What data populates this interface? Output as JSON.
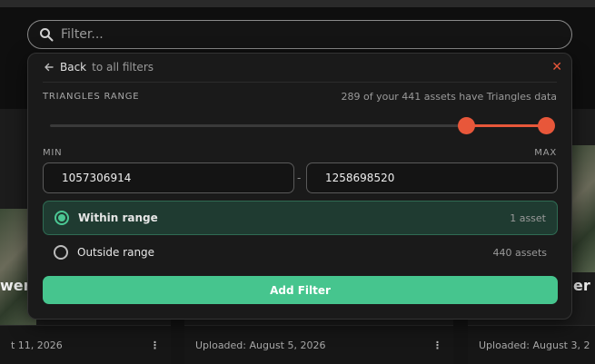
{
  "search": {
    "placeholder": "Filter..."
  },
  "panel": {
    "back_label": "Back",
    "back_suffix": "to all filters",
    "section_title": "TRIANGLES RANGE",
    "section_info": "289 of your 441 assets have Triangles data",
    "slider": {
      "low_fraction": 0.83,
      "high_fraction": 0.99,
      "accent_color": "#e8573a"
    },
    "min_label": "MIN",
    "max_label": "MAX",
    "min_value": "1057306914",
    "max_value": "1258698520",
    "separator": "-",
    "options": [
      {
        "label": "Within range",
        "count": "1 asset",
        "selected": true
      },
      {
        "label": "Outside range",
        "count": "440 assets",
        "selected": false
      }
    ],
    "add_button": "Add Filter",
    "button_color": "#46c58e"
  },
  "cards": [
    {
      "title": "wer",
      "uploaded": "t 11, 2026"
    },
    {
      "title": "",
      "uploaded": "Uploaded: August 5, 2026"
    },
    {
      "title": "er R",
      "uploaded": "Uploaded: August 3, 2"
    }
  ]
}
